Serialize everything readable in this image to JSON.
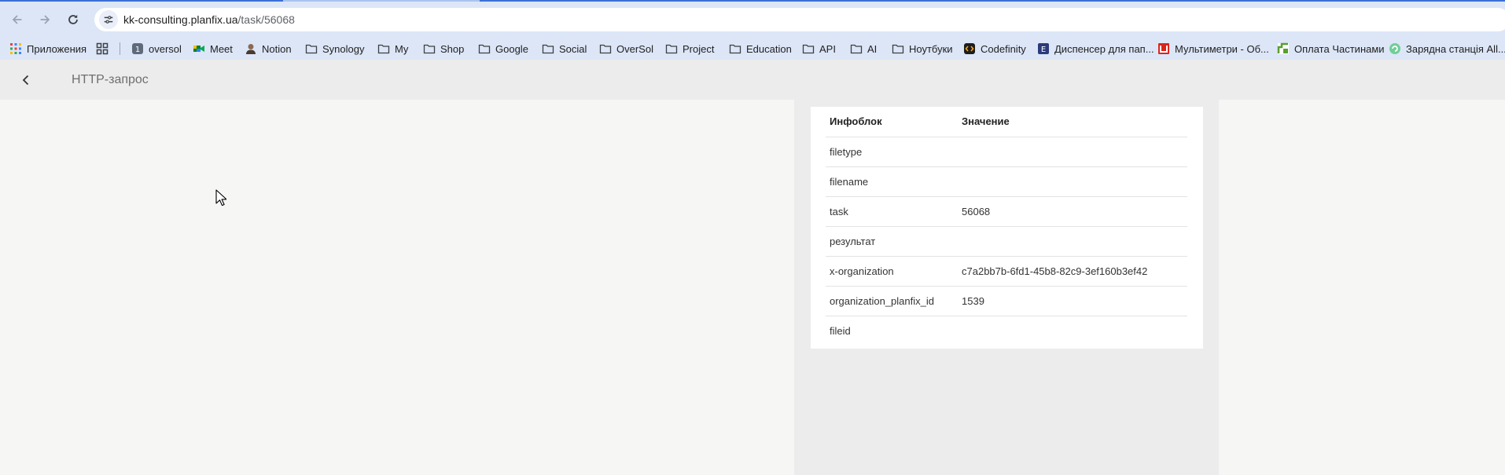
{
  "browser": {
    "url_host": "kk-consulting.planfix.ua",
    "url_path": "/task/56068",
    "bookmarks": [
      {
        "label": "Приложения",
        "icon": "apps-grid-icon"
      },
      {
        "label": "",
        "icon": "grid-squares-icon"
      },
      {
        "label": "oversol",
        "icon": "oversol-favicon-icon"
      },
      {
        "label": "Meet",
        "icon": "google-meet-icon"
      },
      {
        "label": "Notion",
        "icon": "notion-avatar-icon"
      },
      {
        "label": "Synology",
        "icon": "folder-icon"
      },
      {
        "label": "My",
        "icon": "folder-icon"
      },
      {
        "label": "Shop",
        "icon": "folder-icon"
      },
      {
        "label": "Google",
        "icon": "folder-icon"
      },
      {
        "label": "Social",
        "icon": "folder-icon"
      },
      {
        "label": "OverSol",
        "icon": "folder-icon"
      },
      {
        "label": "Project",
        "icon": "folder-icon"
      },
      {
        "label": "Education",
        "icon": "folder-icon"
      },
      {
        "label": "API",
        "icon": "folder-icon"
      },
      {
        "label": "AI",
        "icon": "folder-icon"
      },
      {
        "label": "Ноутбуки",
        "icon": "folder-icon"
      },
      {
        "label": "Codefinity",
        "icon": "codefinity-icon"
      },
      {
        "label": "Диспенсер для пап...",
        "icon": "dispenser-favicon-icon"
      },
      {
        "label": "Мультиметри - Об...",
        "icon": "multimeter-favicon-icon"
      },
      {
        "label": "Оплата Частинами",
        "icon": "privatbank-favicon-icon"
      },
      {
        "label": "Зарядна станція All...",
        "icon": "charging-station-favicon-icon"
      }
    ]
  },
  "app": {
    "title": "HTTP-запрос"
  },
  "table": {
    "headers": [
      "Инфоблок",
      "Значение"
    ],
    "rows": [
      {
        "key": "filetype",
        "value": ""
      },
      {
        "key": "filename",
        "value": ""
      },
      {
        "key": "task",
        "value": "56068"
      },
      {
        "key": "результат",
        "value": ""
      },
      {
        "key": "x-organization",
        "value": "c7a2bb7b-6fd1-45b8-82c9-3ef160b3ef42"
      },
      {
        "key": "organization_planfix_id",
        "value": "1539"
      },
      {
        "key": "fileid",
        "value": ""
      }
    ]
  },
  "colors": {
    "toolbar_bg": "#dce6f7",
    "header_bg": "#ececec",
    "page_bg": "#f6f6f5",
    "accent": "#3b6fd4"
  }
}
